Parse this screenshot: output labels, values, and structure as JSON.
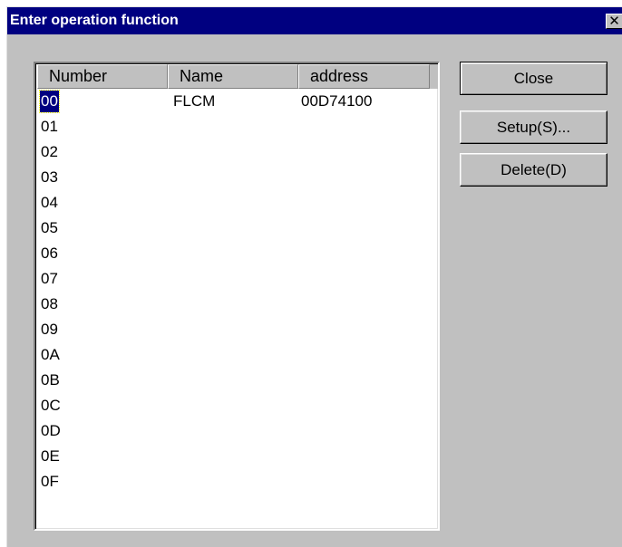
{
  "dialog": {
    "title": "Enter operation function",
    "close_glyph": "✕"
  },
  "list": {
    "columns": [
      "Number",
      "Name",
      "address"
    ],
    "rows": [
      {
        "number": "00",
        "name": "FLCM",
        "address": "00D74100",
        "selected": true
      },
      {
        "number": "01",
        "name": "",
        "address": ""
      },
      {
        "number": "02",
        "name": "",
        "address": ""
      },
      {
        "number": "03",
        "name": "",
        "address": ""
      },
      {
        "number": "04",
        "name": "",
        "address": ""
      },
      {
        "number": "05",
        "name": "",
        "address": ""
      },
      {
        "number": "06",
        "name": "",
        "address": ""
      },
      {
        "number": "07",
        "name": "",
        "address": ""
      },
      {
        "number": "08",
        "name": "",
        "address": ""
      },
      {
        "number": "09",
        "name": "",
        "address": ""
      },
      {
        "number": "0A",
        "name": "",
        "address": ""
      },
      {
        "number": "0B",
        "name": "",
        "address": ""
      },
      {
        "number": "0C",
        "name": "",
        "address": ""
      },
      {
        "number": "0D",
        "name": "",
        "address": ""
      },
      {
        "number": "0E",
        "name": "",
        "address": ""
      },
      {
        "number": "0F",
        "name": "",
        "address": ""
      }
    ]
  },
  "buttons": {
    "close_label": "Close",
    "setup_label": "Setup(S)...",
    "delete_label": "Delete(D)"
  },
  "colors": {
    "titlebar": "#000080",
    "dialog_face": "#c0c0c0",
    "selection": "#000080"
  }
}
